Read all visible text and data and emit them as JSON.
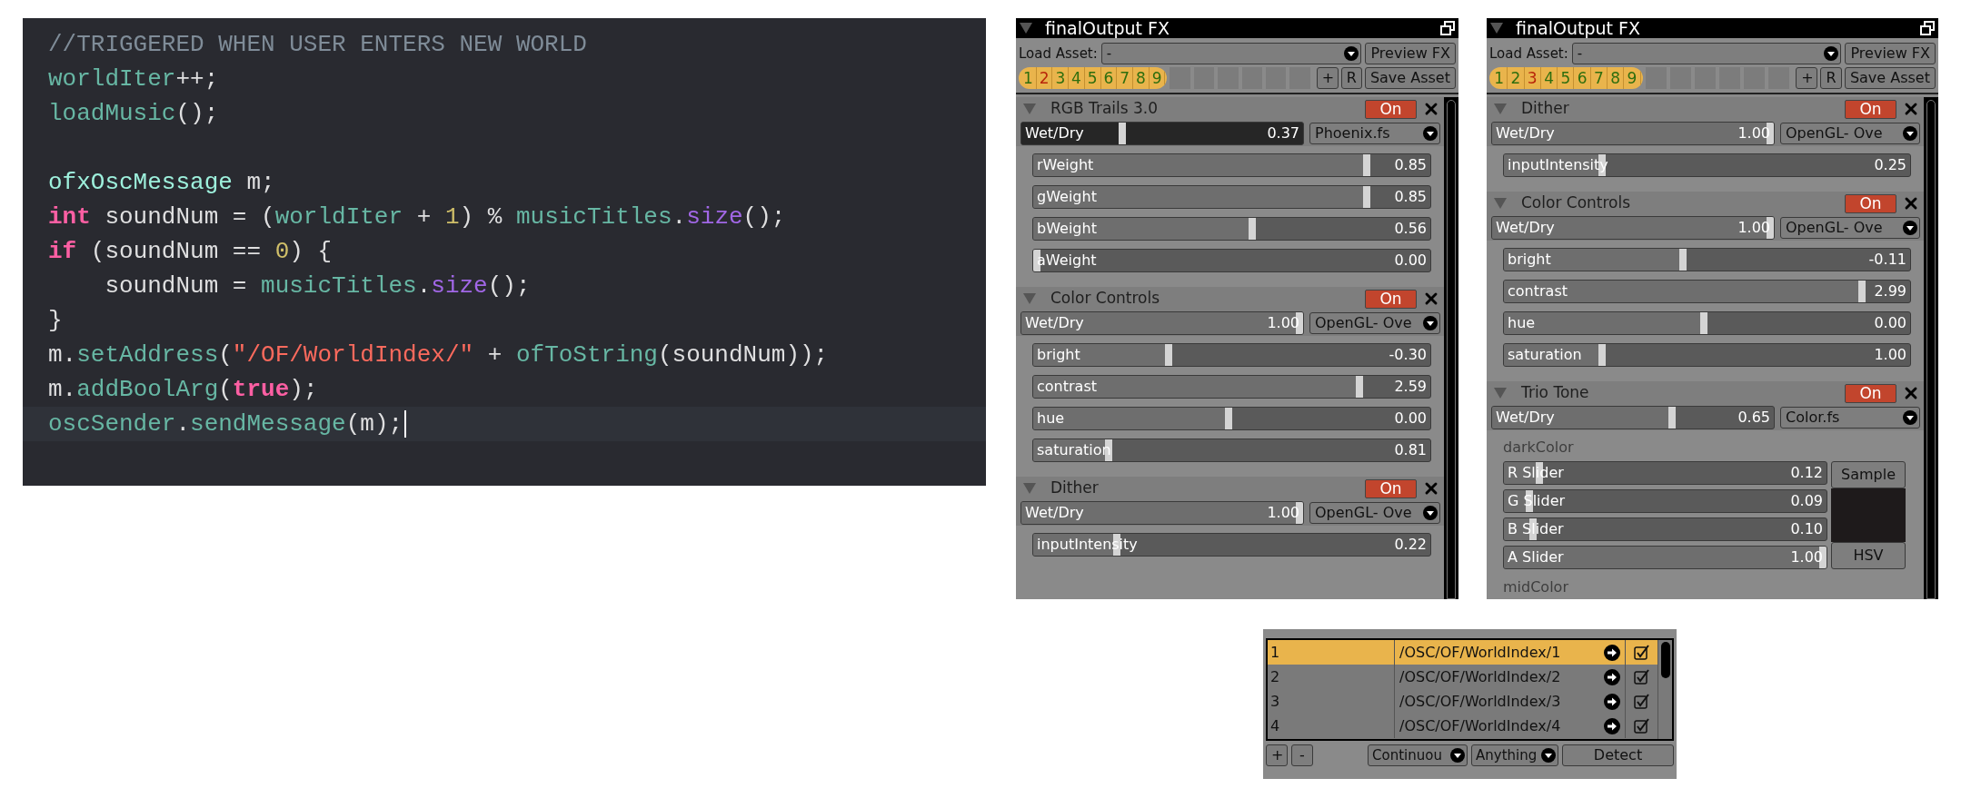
{
  "code_editor": {
    "lines": [
      {
        "kind": "code",
        "highlighted": false,
        "tokens": [
          {
            "kind": "comment",
            "text": "//TRIGGERED WHEN USER ENTERS NEW WORLD"
          }
        ]
      },
      {
        "kind": "code",
        "highlighted": false,
        "tokens": [
          {
            "kind": "ident",
            "text": "worldIter"
          },
          {
            "kind": "plain",
            "text": "++;"
          }
        ]
      },
      {
        "kind": "code",
        "highlighted": false,
        "tokens": [
          {
            "kind": "ident",
            "text": "loadMusic"
          },
          {
            "kind": "plain",
            "text": "();"
          }
        ]
      },
      {
        "kind": "blank"
      },
      {
        "kind": "code",
        "highlighted": false,
        "tokens": [
          {
            "kind": "class",
            "text": "ofxOscMessage"
          },
          {
            "kind": "plain",
            "text": " m;"
          }
        ]
      },
      {
        "kind": "code",
        "highlighted": false,
        "tokens": [
          {
            "kind": "keyword",
            "text": "int"
          },
          {
            "kind": "plain",
            "text": " soundNum = ("
          },
          {
            "kind": "ident",
            "text": "worldIter"
          },
          {
            "kind": "plain",
            "text": " + "
          },
          {
            "kind": "number",
            "text": "1"
          },
          {
            "kind": "plain",
            "text": ") % "
          },
          {
            "kind": "ident",
            "text": "musicTitles"
          },
          {
            "kind": "plain",
            "text": "."
          },
          {
            "kind": "method",
            "text": "size"
          },
          {
            "kind": "plain",
            "text": "();"
          }
        ]
      },
      {
        "kind": "code",
        "highlighted": false,
        "tokens": [
          {
            "kind": "keyword",
            "text": "if"
          },
          {
            "kind": "plain",
            "text": " (soundNum == "
          },
          {
            "kind": "number",
            "text": "0"
          },
          {
            "kind": "plain",
            "text": ") {"
          }
        ]
      },
      {
        "kind": "code",
        "highlighted": false,
        "tokens": [
          {
            "kind": "plain",
            "text": "    soundNum = "
          },
          {
            "kind": "ident",
            "text": "musicTitles"
          },
          {
            "kind": "plain",
            "text": "."
          },
          {
            "kind": "method",
            "text": "size"
          },
          {
            "kind": "plain",
            "text": "();"
          }
        ]
      },
      {
        "kind": "code",
        "highlighted": false,
        "tokens": [
          {
            "kind": "plain",
            "text": "}"
          }
        ]
      },
      {
        "kind": "code",
        "highlighted": false,
        "tokens": [
          {
            "kind": "plain",
            "text": "m."
          },
          {
            "kind": "ident",
            "text": "setAddress"
          },
          {
            "kind": "plain",
            "text": "("
          },
          {
            "kind": "string",
            "text": "\"/OF/WorldIndex/\""
          },
          {
            "kind": "plain",
            "text": " + "
          },
          {
            "kind": "ident",
            "text": "ofToString"
          },
          {
            "kind": "plain",
            "text": "(soundNum));"
          }
        ]
      },
      {
        "kind": "code",
        "highlighted": false,
        "tokens": [
          {
            "kind": "plain",
            "text": "m."
          },
          {
            "kind": "ident",
            "text": "addBoolArg"
          },
          {
            "kind": "plain",
            "text": "("
          },
          {
            "kind": "keyword",
            "text": "true"
          },
          {
            "kind": "plain",
            "text": ");"
          }
        ]
      },
      {
        "kind": "code",
        "highlighted": true,
        "tokens": [
          {
            "kind": "ident",
            "text": "oscSender"
          },
          {
            "kind": "plain",
            "text": "."
          },
          {
            "kind": "ident",
            "text": "sendMessage"
          },
          {
            "kind": "plain",
            "text": "(m);"
          }
        ]
      }
    ]
  },
  "fx_panels": [
    {
      "title": "finalOutput FX",
      "load_asset": {
        "label": "Load Asset:",
        "value": "-"
      },
      "preview_button": "Preview FX",
      "add_button": "+",
      "reset_button": "R",
      "save_button": "Save Asset",
      "presets": [
        {
          "label": "1",
          "selected": false
        },
        {
          "label": "2",
          "selected": true
        },
        {
          "label": "3",
          "selected": false
        },
        {
          "label": "4",
          "selected": false
        },
        {
          "label": "5",
          "selected": false
        },
        {
          "label": "6",
          "selected": false
        },
        {
          "label": "7",
          "selected": false
        },
        {
          "label": "8",
          "selected": false
        },
        {
          "label": "9",
          "selected": false
        }
      ],
      "effects": [
        {
          "name": "RGB Trails 3.0",
          "on": true,
          "on_label": "On",
          "wet_dry": {
            "label": "Wet/Dry",
            "value": "0.37",
            "level": 0.37,
            "selected": true
          },
          "shader": "Phoenix.fs",
          "params": [
            {
              "kind": "slider",
              "label": "rWeight",
              "value": "0.85",
              "level": 0.85
            },
            {
              "kind": "slider",
              "label": "gWeight",
              "value": "0.85",
              "level": 0.85
            },
            {
              "kind": "slider",
              "label": "bWeight",
              "value": "0.56",
              "level": 0.56
            },
            {
              "kind": "slider",
              "label": "aWeight",
              "value": "0.00",
              "level": 0
            }
          ]
        },
        {
          "name": "Color Controls",
          "on": true,
          "on_label": "On",
          "wet_dry": {
            "label": "Wet/Dry",
            "value": "1.00",
            "level": 1,
            "selected": false
          },
          "shader": "OpenGL- Ove",
          "params": [
            {
              "kind": "slider",
              "label": "bright",
              "value": "-0.30",
              "level": 0.35
            },
            {
              "kind": "slider",
              "label": "contrast",
              "value": "2.59",
              "level": 0.83
            },
            {
              "kind": "slider",
              "label": "hue",
              "value": "0.00",
              "level": 0.5
            },
            {
              "kind": "slider",
              "label": "saturation",
              "value": "0.81",
              "level": 0.2
            }
          ]
        },
        {
          "name": "Dither",
          "on": true,
          "on_label": "On",
          "wet_dry": {
            "label": "Wet/Dry",
            "value": "1.00",
            "level": 1,
            "selected": false
          },
          "shader": "OpenGL- Ove",
          "params": [
            {
              "kind": "slider",
              "label": "inputIntensity",
              "value": "0.22",
              "level": 0.22
            }
          ]
        }
      ]
    },
    {
      "title": "finalOutput FX",
      "load_asset": {
        "label": "Load Asset:",
        "value": "-"
      },
      "preview_button": "Preview FX",
      "add_button": "+",
      "reset_button": "R",
      "save_button": "Save Asset",
      "presets": [
        {
          "label": "1",
          "selected": false
        },
        {
          "label": "2",
          "selected": false
        },
        {
          "label": "3",
          "selected": true
        },
        {
          "label": "4",
          "selected": false
        },
        {
          "label": "5",
          "selected": false
        },
        {
          "label": "6",
          "selected": false
        },
        {
          "label": "7",
          "selected": false
        },
        {
          "label": "8",
          "selected": false
        },
        {
          "label": "9",
          "selected": false
        }
      ],
      "effects": [
        {
          "name": "Dither",
          "on": true,
          "on_label": "On",
          "wet_dry": {
            "label": "Wet/Dry",
            "value": "1.00",
            "level": 1,
            "selected": false
          },
          "shader": "OpenGL- Ove",
          "params": [
            {
              "kind": "slider",
              "label": "inputIntensity",
              "value": "0.25",
              "level": 0.25
            }
          ]
        },
        {
          "name": "Color Controls",
          "on": true,
          "on_label": "On",
          "wet_dry": {
            "label": "Wet/Dry",
            "value": "1.00",
            "level": 1,
            "selected": false
          },
          "shader": "OpenGL- Ove",
          "params": [
            {
              "kind": "slider",
              "label": "bright",
              "value": "-0.11",
              "level": 0.45
            },
            {
              "kind": "slider",
              "label": "contrast",
              "value": "2.99",
              "level": 0.89
            },
            {
              "kind": "slider",
              "label": "hue",
              "value": "0.00",
              "level": 0.5
            },
            {
              "kind": "slider",
              "label": "saturation",
              "value": "1.00",
              "level": 0.25
            }
          ]
        },
        {
          "name": "Trio Tone",
          "on": true,
          "on_label": "On",
          "wet_dry": {
            "label": "Wet/Dry",
            "value": "0.65",
            "level": 0.65,
            "selected": false
          },
          "shader": "Color.fs",
          "params": [
            {
              "kind": "color",
              "label": "darkColor",
              "sample_button": "Sample",
              "hsv_button": "HSV",
              "color": "#1e1a1b",
              "sliders": [
                {
                  "label": "R Slider",
                  "value": "0.12",
                  "level": 0.12
                },
                {
                  "label": "G Slider",
                  "value": "0.09",
                  "level": 0.09
                },
                {
                  "label": "B Slider",
                  "value": "0.10",
                  "level": 0.1
                },
                {
                  "label": "A Slider",
                  "value": "1.00",
                  "level": 1
                }
              ]
            },
            {
              "kind": "label",
              "label": "midColor"
            }
          ]
        }
      ]
    }
  ],
  "osc_panel": {
    "rows": [
      {
        "index": "1",
        "address": "/OSC/OF/WorldIndex/1",
        "checked": true,
        "selected": true
      },
      {
        "index": "2",
        "address": "/OSC/OF/WorldIndex/2",
        "checked": true,
        "selected": false
      },
      {
        "index": "3",
        "address": "/OSC/OF/WorldIndex/3",
        "checked": true,
        "selected": false
      },
      {
        "index": "4",
        "address": "/OSC/OF/WorldIndex/4",
        "checked": true,
        "selected": false
      }
    ],
    "add_button": "+",
    "remove_button": "-",
    "mode_dropdown": "Continuou",
    "type_dropdown": "Anything",
    "detect_button": "Detect"
  }
}
